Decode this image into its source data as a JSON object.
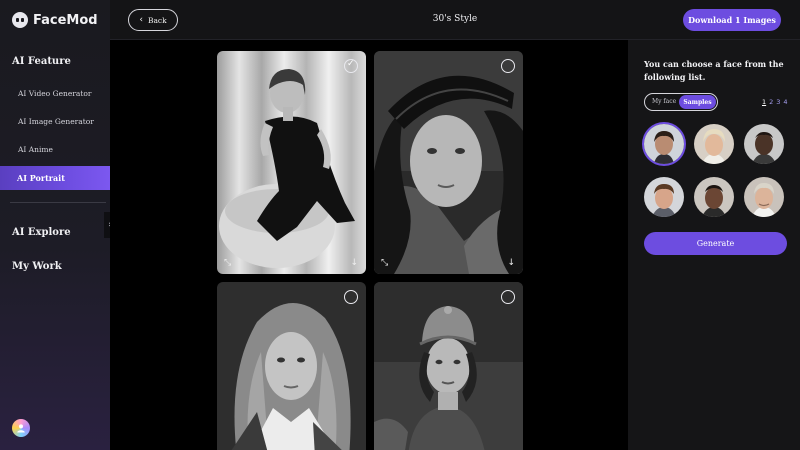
{
  "app": {
    "name": "FaceMod"
  },
  "sidebar": {
    "sections": [
      {
        "label": "AI Feature"
      },
      {
        "label": "AI Explore"
      },
      {
        "label": "My Work"
      }
    ],
    "items": [
      {
        "label": "AI Video Generator",
        "active": false
      },
      {
        "label": "AI Image Generator",
        "active": false
      },
      {
        "label": "AI Anime",
        "active": false
      },
      {
        "label": "AI Portrait",
        "active": true
      }
    ],
    "collapse_icon": "chevron-right-icon"
  },
  "header": {
    "back_label": "Back",
    "title": "30's Style",
    "download_label": "Download 1 Images"
  },
  "gallery": {
    "photos": [
      {
        "name": "woman-black-dress",
        "selected": true
      },
      {
        "name": "woman-beret",
        "selected": false
      },
      {
        "name": "woman-long-hair",
        "selected": false
      },
      {
        "name": "woman-hat-uniform",
        "selected": false
      }
    ]
  },
  "panel": {
    "instruction": "You can choose a face from the following list.",
    "toggle": {
      "left": "My face",
      "right": "Samples",
      "active": "Samples"
    },
    "pages": [
      "1",
      "2",
      "3",
      "4"
    ],
    "current_page": "1",
    "faces": [
      {
        "name": "face-sample-1",
        "selected": true
      },
      {
        "name": "face-sample-2",
        "selected": false
      },
      {
        "name": "face-sample-3",
        "selected": false
      },
      {
        "name": "face-sample-4",
        "selected": false
      },
      {
        "name": "face-sample-5",
        "selected": false
      },
      {
        "name": "face-sample-6",
        "selected": false
      }
    ],
    "generate_label": "Generate"
  },
  "colors": {
    "accent": "#6d4de0",
    "background": "#0b0b0c",
    "panel": "#151517"
  }
}
